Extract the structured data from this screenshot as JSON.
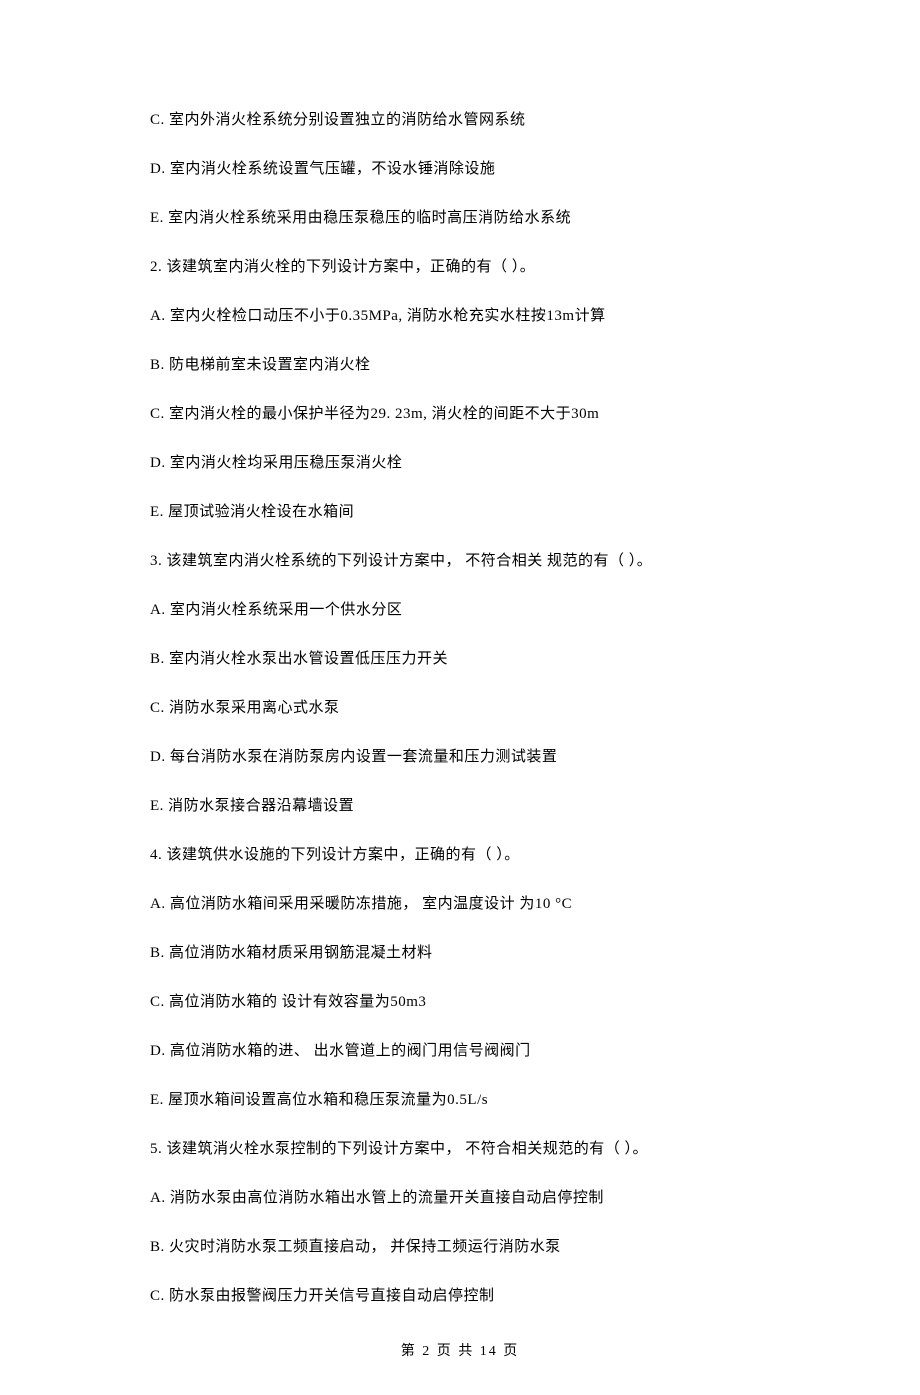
{
  "lines": [
    "C. 室内外消火栓系统分别设置独立的消防给水管网系统",
    "D. 室内消火栓系统设置气压罐，不设水锤消除设施",
    "E. 室内消火栓系统采用由稳压泵稳压的临时高压消防给水系统",
    "2. 该建筑室内消火栓的下列设计方案中，正确的有（    ）。",
    "A. 室内火栓检口动压不小于0.35MPa, 消防水枪充实水柱按13m计算",
    "B. 防电梯前室未设置室内消火栓",
    "C. 室内消火栓的最小保护半径为29. 23m, 消火栓的间距不大于30m",
    "D. 室内消火栓均采用压稳压泵消火栓",
    "E. 屋顶试验消火栓设在水箱间",
    "3. 该建筑室内消火栓系统的下列设计方案中， 不符合相关 规范的有（    ）。",
    "A. 室内消火栓系统采用一个供水分区",
    "B. 室内消火栓水泵出水管设置低压压力开关",
    "C. 消防水泵采用离心式水泵",
    "D. 每台消防水泵在消防泵房内设置一套流量和压力测试装置",
    "E. 消防水泵接合器沿幕墙设置",
    "4. 该建筑供水设施的下列设计方案中，正确的有（    ）。",
    "A. 高位消防水箱间采用采暖防冻措施， 室内温度设计 为10 °C",
    "B. 高位消防水箱材质采用钢筋混凝土材料",
    "C. 高位消防水箱的 设计有效容量为50m3",
    "D. 高位消防水箱的进、 出水管道上的阀门用信号阀阀门",
    "E. 屋顶水箱间设置高位水箱和稳压泵流量为0.5L/s",
    "5. 该建筑消火栓水泵控制的下列设计方案中， 不符合相关规范的有（    ）。",
    "A. 消防水泵由高位消防水箱出水管上的流量开关直接自动启停控制",
    "B. 火灾时消防水泵工频直接启动， 并保持工频运行消防水泵",
    "C. 防水泵由报警阀压力开关信号直接自动启停控制"
  ],
  "footer": "第 2 页 共 14 页"
}
